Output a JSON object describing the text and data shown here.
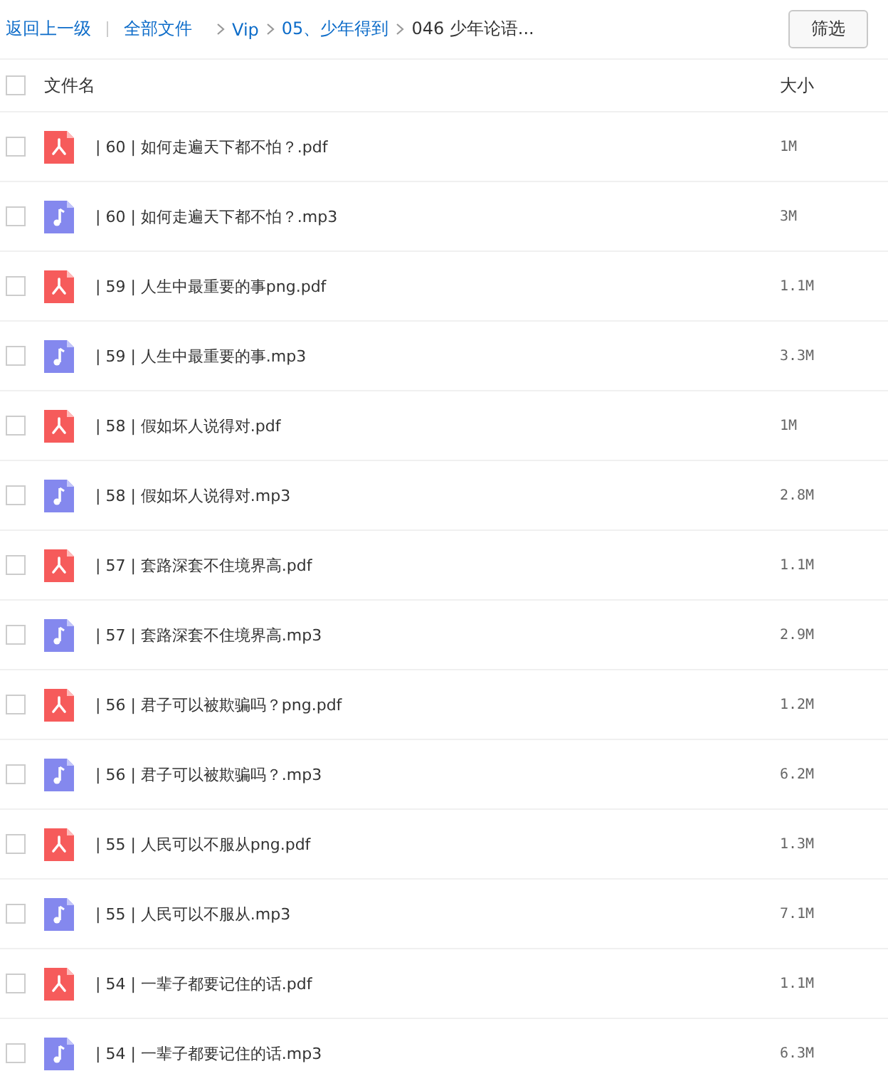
{
  "breadcrumb": {
    "back": "返回上一级",
    "items": [
      {
        "label": "全部文件",
        "kind": "link"
      },
      {
        "label": "Vip",
        "kind": "link"
      },
      {
        "label": "05、少年得到",
        "kind": "link"
      },
      {
        "label": "046 少年论语...",
        "kind": "current"
      }
    ]
  },
  "filter_button": "筛选",
  "table": {
    "columns": [
      "文件名",
      "大小"
    ],
    "select_all": {
      "checked": false
    },
    "rows": [
      {
        "kind": "pdf",
        "name": "| 60 |  如何走遍天下都不怕？.pdf",
        "size": "1M",
        "checked": false
      },
      {
        "kind": "audio",
        "name": "| 60 |  如何走遍天下都不怕？.mp3",
        "size": "3M",
        "checked": false
      },
      {
        "kind": "pdf",
        "name": "| 59 |  人生中最重要的事png.pdf",
        "size": "1.1M",
        "checked": false
      },
      {
        "kind": "audio",
        "name": "| 59 |  人生中最重要的事.mp3",
        "size": "3.3M",
        "checked": false
      },
      {
        "kind": "pdf",
        "name": "| 58 |  假如坏人说得对.pdf",
        "size": "1M",
        "checked": false
      },
      {
        "kind": "audio",
        "name": "| 58 |  假如坏人说得对.mp3",
        "size": "2.8M",
        "checked": false
      },
      {
        "kind": "pdf",
        "name": "| 57 | 套路深套不住境界高.pdf",
        "size": "1.1M",
        "checked": false
      },
      {
        "kind": "audio",
        "name": "| 57 | 套路深套不住境界高.mp3",
        "size": "2.9M",
        "checked": false
      },
      {
        "kind": "pdf",
        "name": "| 56 |  君子可以被欺骗吗？png.pdf",
        "size": "1.2M",
        "checked": false
      },
      {
        "kind": "audio",
        "name": "| 56 |  君子可以被欺骗吗？.mp3",
        "size": "6.2M",
        "checked": false
      },
      {
        "kind": "pdf",
        "name": "| 55 |  人民可以不服从png.pdf",
        "size": "1.3M",
        "checked": false
      },
      {
        "kind": "audio",
        "name": "| 55 |  人民可以不服从.mp3",
        "size": "7.1M",
        "checked": false
      },
      {
        "kind": "pdf",
        "name": "| 54 |  一辈子都要记住的话.pdf",
        "size": "1.1M",
        "checked": false
      },
      {
        "kind": "audio",
        "name": "| 54 |  一辈子都要记住的话.mp3",
        "size": "6.3M",
        "checked": false
      }
    ]
  }
}
